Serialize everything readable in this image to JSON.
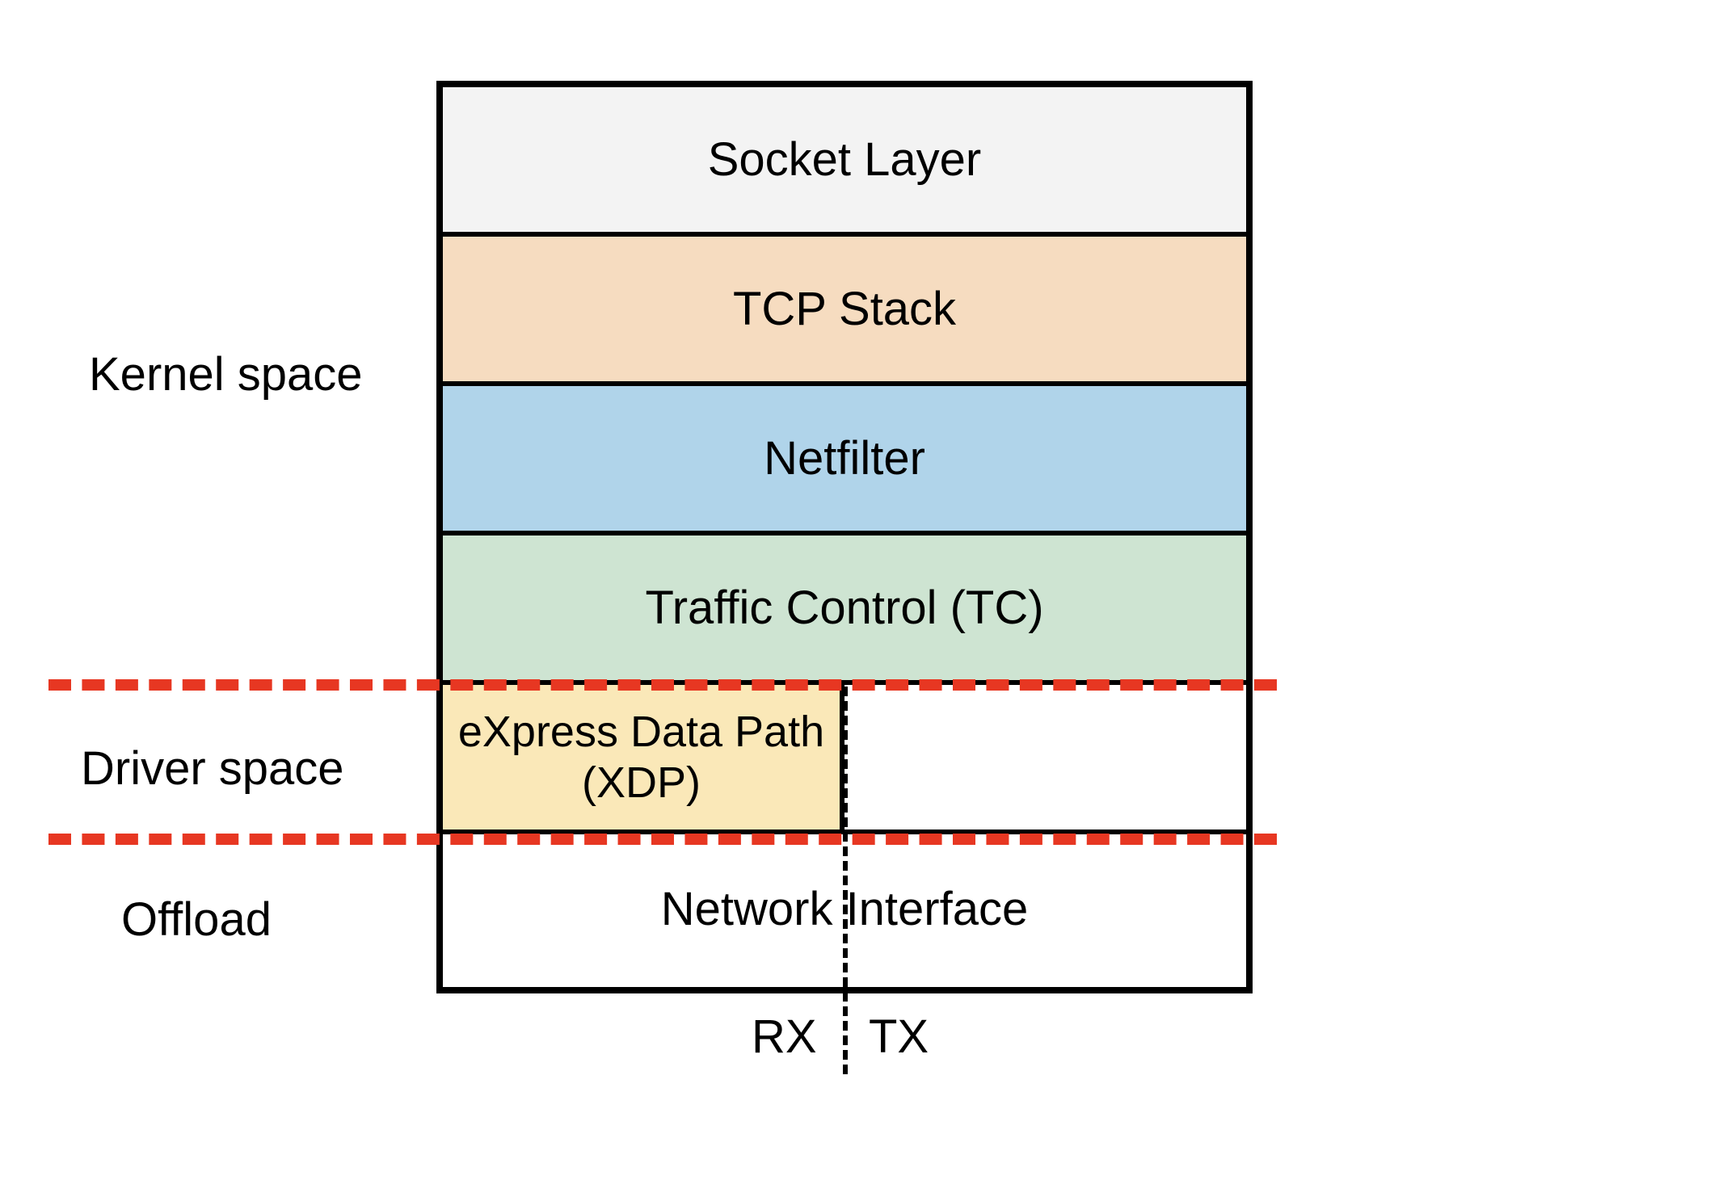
{
  "side_labels": {
    "kernel": "Kernel space",
    "driver": "Driver space",
    "offload": "Offload"
  },
  "layers": {
    "socket": "Socket Layer",
    "tcp": "TCP Stack",
    "netfilter": "Netfilter",
    "tc": "Traffic Control (TC)",
    "xdp": "eXpress Data Path (XDP)",
    "nic": "Network Interface"
  },
  "bottom": {
    "rx": "RX",
    "tx": "TX"
  },
  "colors": {
    "socket": "#f3f3f3",
    "tcp": "#f6dcc0",
    "netfilter": "#b0d4ea",
    "tc": "#cee4d2",
    "xdp": "#fae8b8",
    "divider": "#e73722"
  }
}
